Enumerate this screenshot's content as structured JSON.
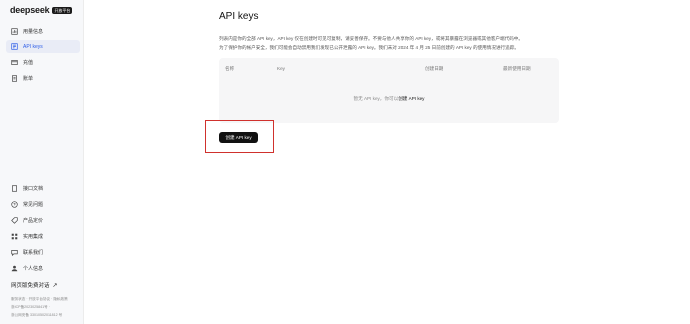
{
  "brand": {
    "name": "deepseek",
    "badge": "开放平台"
  },
  "sidebar": {
    "items": [
      {
        "label": "用量信息",
        "icon": "chart-icon",
        "active": false
      },
      {
        "label": "API keys",
        "icon": "key-icon",
        "active": true
      },
      {
        "label": "充值",
        "icon": "wallet-icon",
        "active": false
      },
      {
        "label": "账单",
        "icon": "bill-icon",
        "active": false
      }
    ],
    "bottom_items": [
      {
        "label": "接口文档",
        "icon": "doc-icon"
      },
      {
        "label": "常见问题",
        "icon": "help-icon"
      },
      {
        "label": "产品定价",
        "icon": "price-icon"
      },
      {
        "label": "实用集成",
        "icon": "integration-icon"
      },
      {
        "label": "联系我们",
        "icon": "chat-icon"
      },
      {
        "label": "个人信息",
        "icon": "user-icon"
      }
    ],
    "web_link": "网页版免费对话",
    "footer": [
      "服务状态 · 开放平台协议 · 隐私政策",
      "浙ICP备2023025841号 ·",
      "浙公网安备 33010502011812 号"
    ]
  },
  "main": {
    "title": "API keys",
    "description": [
      "列表内是你的全部 API key，API key 仅在创建时可见可复制，请妥善保存。不要与他人共享你的 API key，或将其暴露在浏览器或其他客户端代码中。",
      "为了保护你的帐户安全，我们可能会自动禁用我们发现已公开泄露的 API key。我们未对 2024 年 4 月 25 日前创建的 API key 的使用情况进行追踪。"
    ],
    "table": {
      "columns": [
        "名称",
        "Key",
        "创建日期",
        "最新使用日期"
      ],
      "empty_text": "暂无 API key，你可以",
      "empty_link": "创建 API key"
    },
    "create_button": "创建 API key"
  },
  "colors": {
    "accent": "#2d5de8",
    "highlight": "#d0312d",
    "button": "#111111"
  }
}
